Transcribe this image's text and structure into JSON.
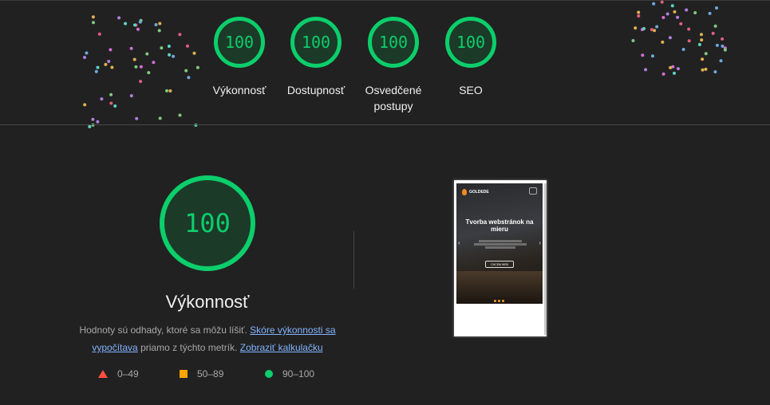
{
  "gauges": [
    {
      "score": "100",
      "label": "Výkonnosť"
    },
    {
      "score": "100",
      "label": "Dostupnosť"
    },
    {
      "score": "100",
      "label": "Osvedčené postupy"
    },
    {
      "score": "100",
      "label": "SEO"
    }
  ],
  "main": {
    "score": "100",
    "title": "Výkonnosť",
    "desc_text_1": "Hodnoty sú odhady, ktoré sa môžu líšiť.",
    "desc_link_1": "Skóre výkonnosti sa vypočítava",
    "desc_text_2": "priamo z týchto metrík.",
    "desc_link_2": "Zobraziť kalkulačku"
  },
  "legend": [
    {
      "icon": "triangle-red",
      "range": "0–49"
    },
    {
      "icon": "square-orange",
      "range": "50–89"
    },
    {
      "icon": "circle-green",
      "range": "90–100"
    }
  ],
  "screenshot": {
    "brand": "GOLDEDE",
    "hero_title": "Tvorba webstránok na mieru",
    "cta": "CHCEM WEB"
  },
  "colors": {
    "pass": "#0cce6b",
    "average": "#ffa400",
    "fail": "#ff4e42",
    "link": "#82b4ff"
  }
}
